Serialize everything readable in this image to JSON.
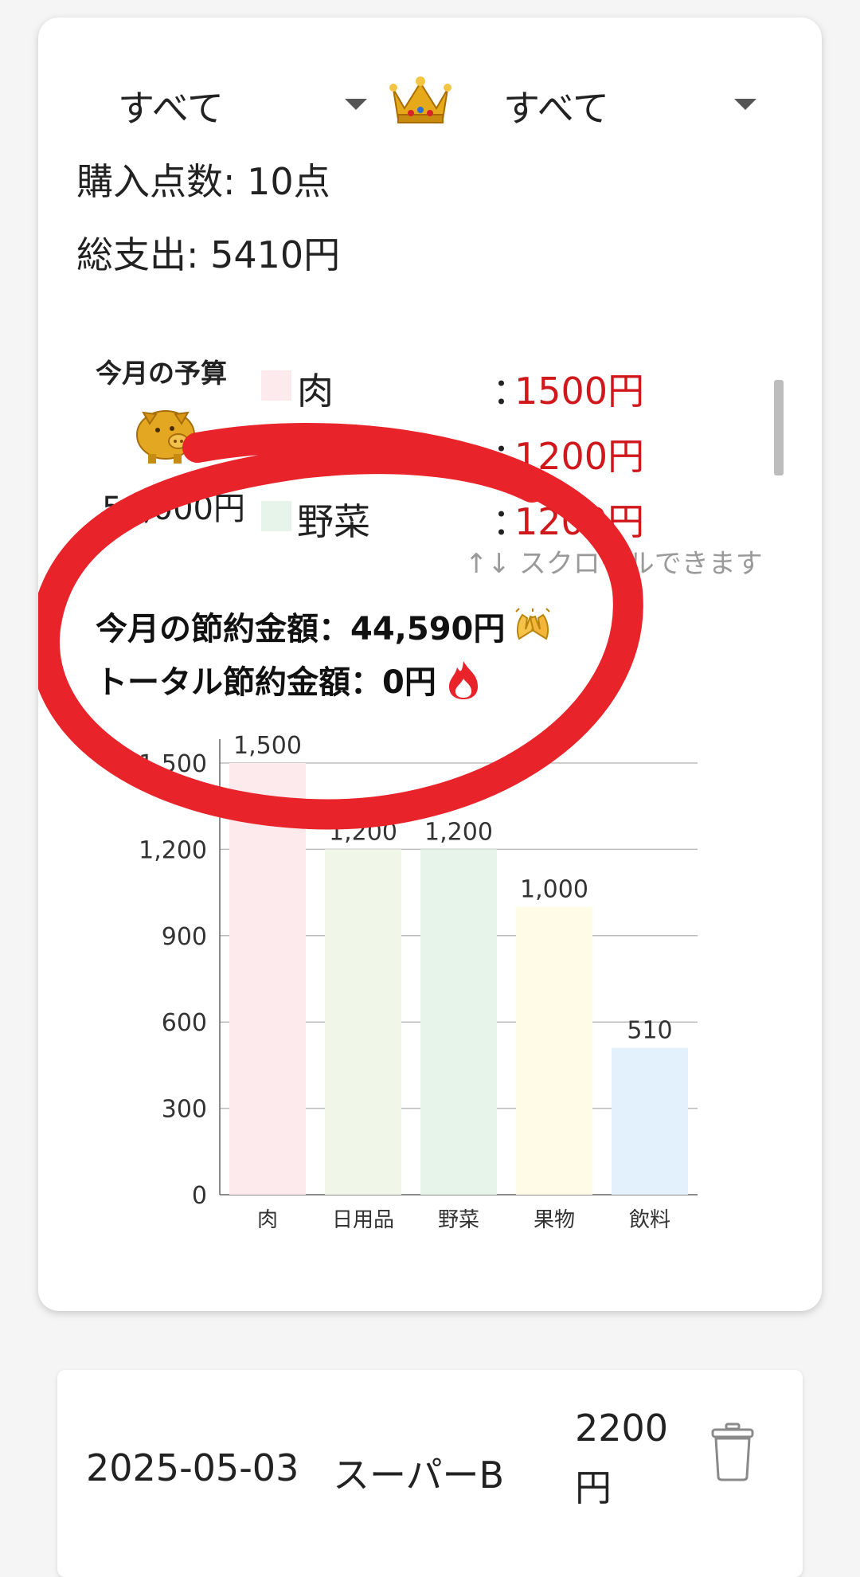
{
  "filters": {
    "left_value": "すべて",
    "right_value": "すべて"
  },
  "summary": {
    "items_count": "購入点数: 10点",
    "total_spend": "総支出: 5410円"
  },
  "budget": {
    "title": "今月の予算",
    "amount": "50,000円"
  },
  "categories": [
    {
      "name": "肉",
      "value": "1500円",
      "color": "#fdeaec"
    },
    {
      "name": "日用品",
      "value": "1200円",
      "color": "#f0f6e8"
    },
    {
      "name": "野菜",
      "value": "1200円",
      "color": "#e6f4ea"
    }
  ],
  "category_colon": "：",
  "scroll_hint": "↑↓ スクロールできます",
  "savings": {
    "monthly": "今月の節約金額：44,590円",
    "total": "トータル節約金額：0円"
  },
  "chart_data": {
    "type": "bar",
    "categories": [
      "肉",
      "日用品",
      "野菜",
      "果物",
      "飲料"
    ],
    "values": [
      1500,
      1200,
      1200,
      1000,
      510
    ],
    "value_labels": [
      "1,500",
      "1,200",
      "1,200",
      "1,000",
      "510"
    ],
    "colors": [
      "#fdeaec",
      "#f0f6e8",
      "#e6f4ea",
      "#fffbe6",
      "#e3f1fd"
    ],
    "yticks": [
      "0",
      "300",
      "600",
      "900",
      "1,200",
      "1,500"
    ],
    "ylim": [
      0,
      1500
    ],
    "grid": true
  },
  "annotation": {
    "color": "#e8232a"
  },
  "record": {
    "date": "2025-05-03",
    "store": "スーパーB",
    "amount_line1": "2200",
    "amount_line2": "円"
  }
}
